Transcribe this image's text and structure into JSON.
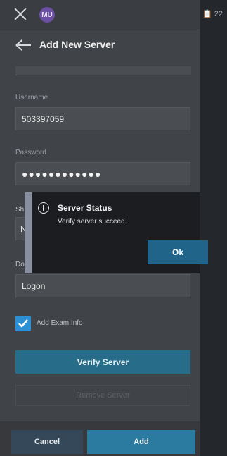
{
  "topbar": {
    "avatar_initials": "MU"
  },
  "header": {
    "title": "Add New Server"
  },
  "form": {
    "username_label": "Username",
    "username_value": "503397059",
    "password_label": "Password",
    "password_mask": "●●●●●●●●●●●●",
    "peek_sh": "Sh",
    "peek_n": "N",
    "peek_do": "Do",
    "logon_value": "Logon"
  },
  "checkbox": {
    "label": "Add Exam Info",
    "checked": true
  },
  "buttons": {
    "verify_server": "Verify Server",
    "remove_server": "Remove Server",
    "cancel": "Cancel",
    "add": "Add"
  },
  "dialog": {
    "title": "Server Status",
    "message": "Verify server succeed.",
    "ok": "Ok"
  },
  "right_strip": {
    "text": "22"
  },
  "colors": {
    "accent": "#2b7ba0",
    "panel": "#404347",
    "dialog": "#1b1d20"
  }
}
